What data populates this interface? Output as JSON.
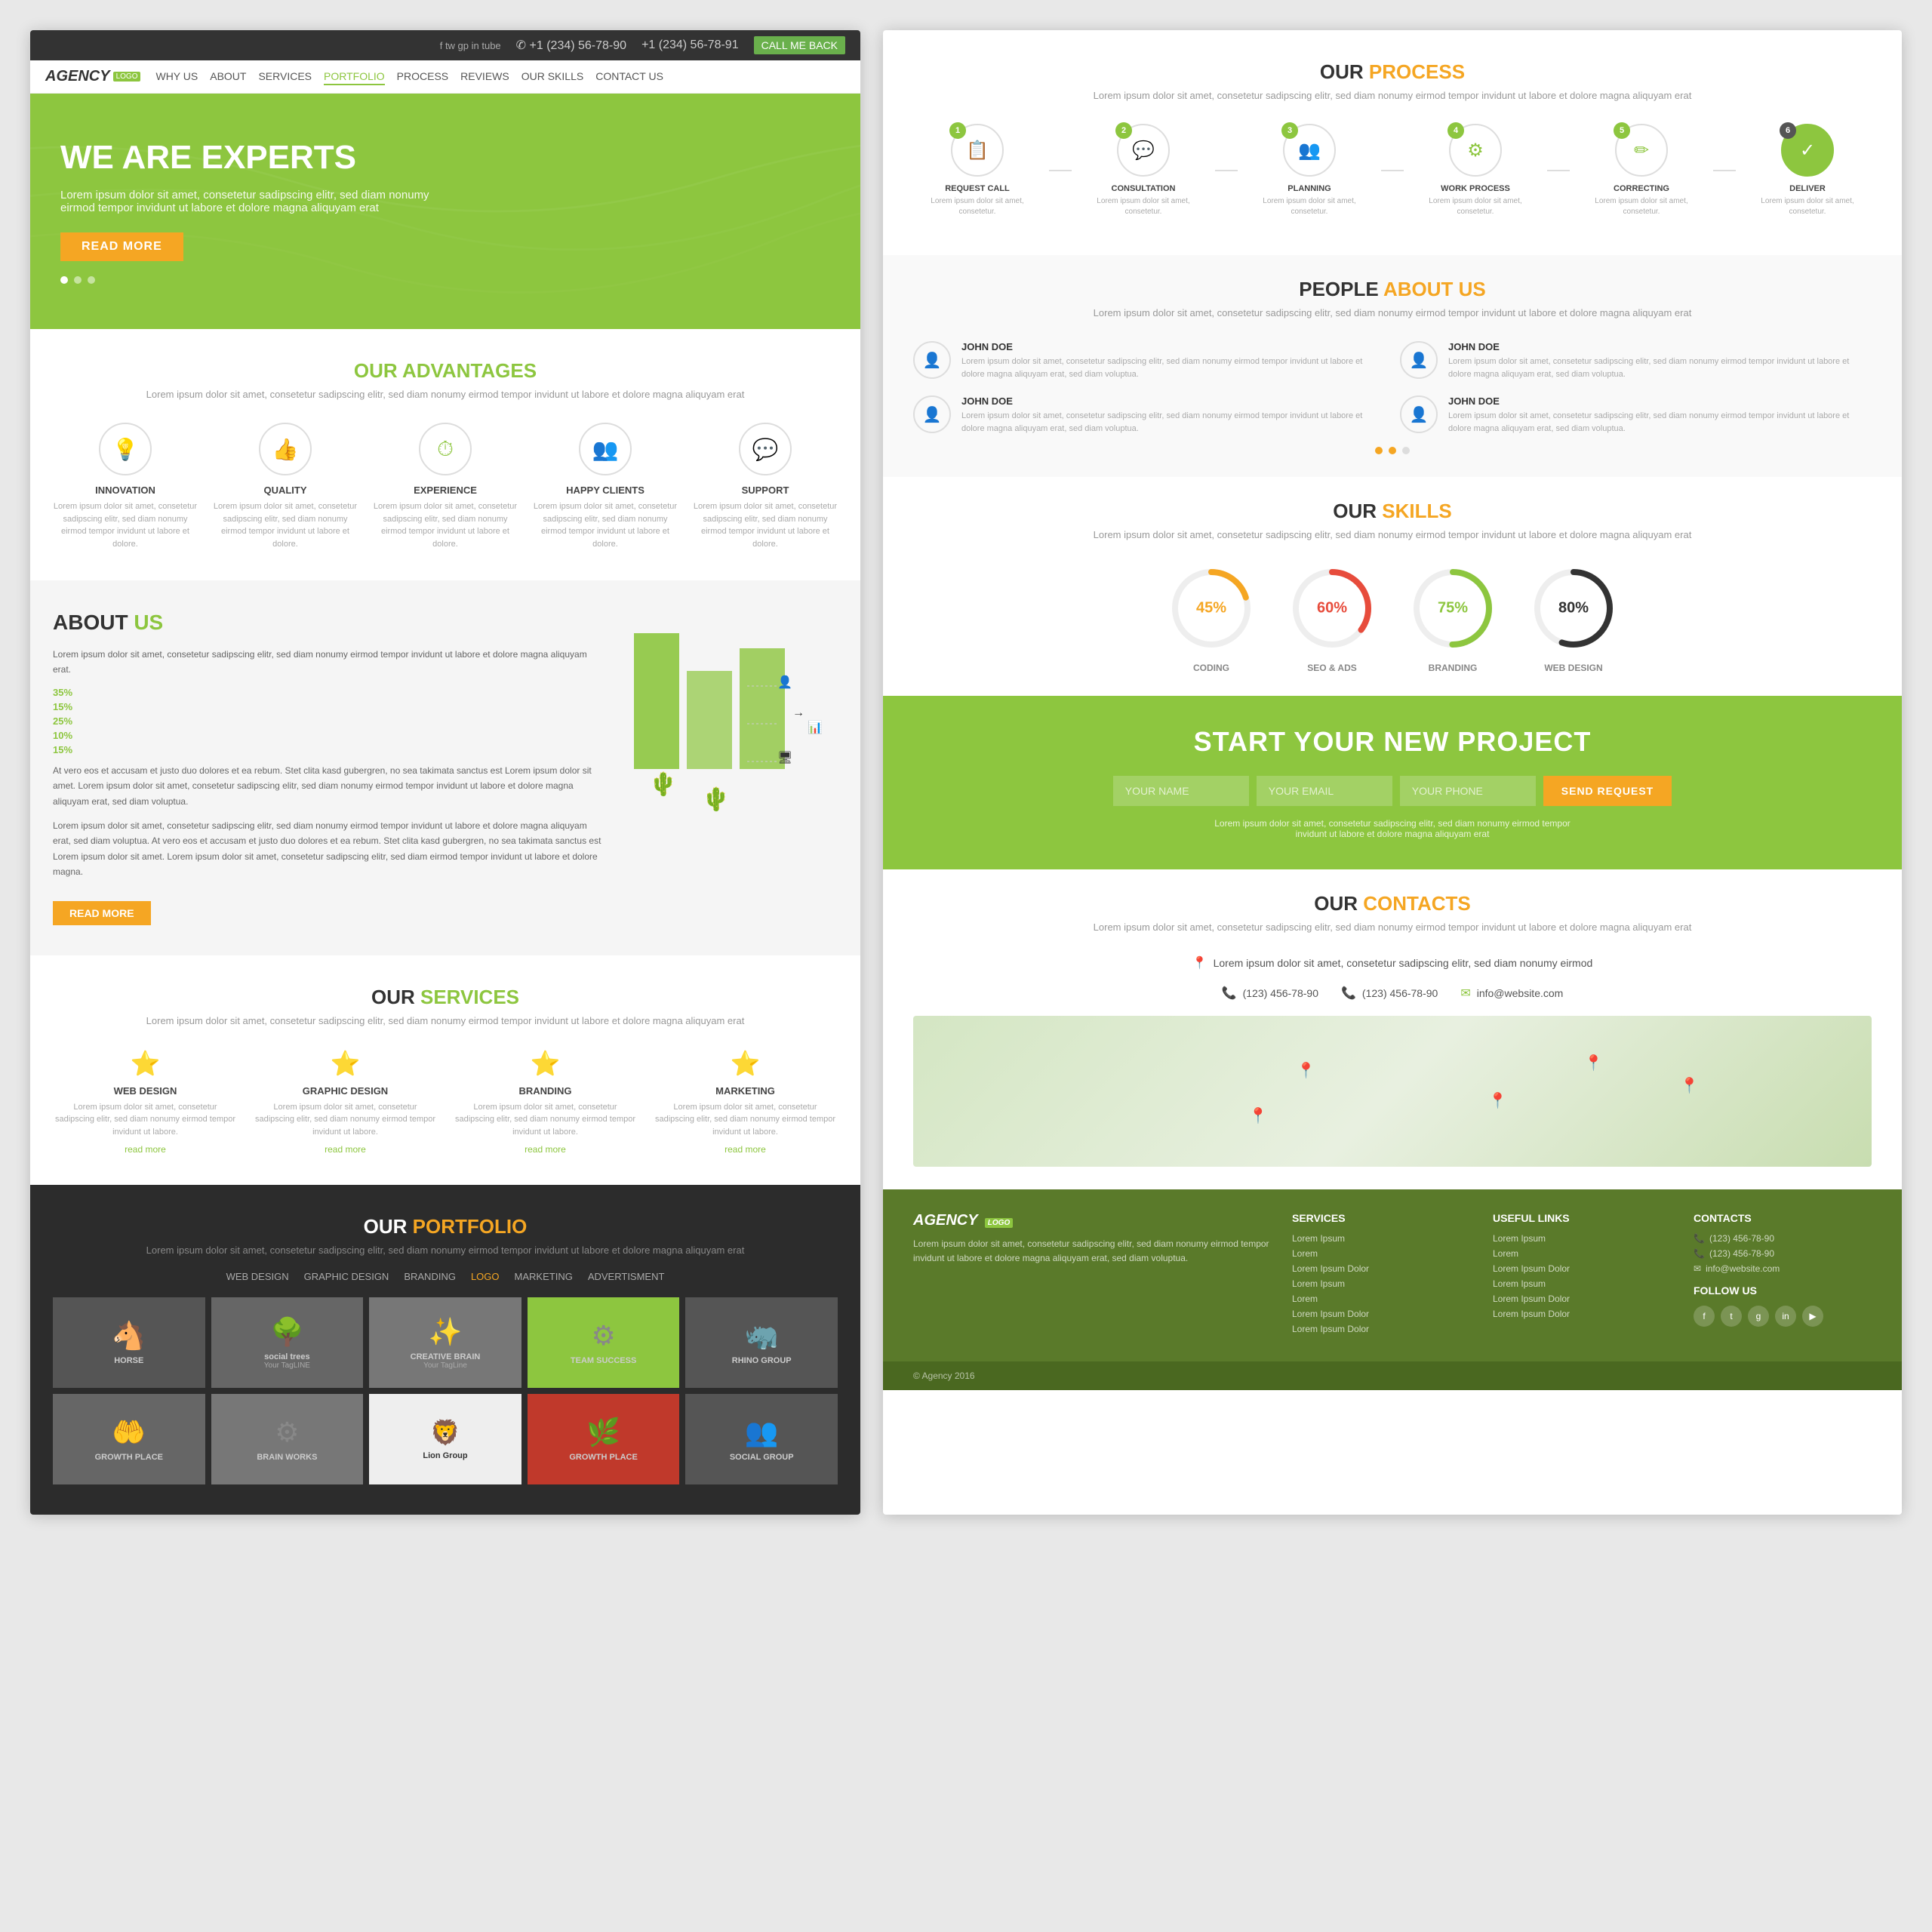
{
  "leftPanel": {
    "topBar": {
      "phone1": "✆ +1 (234) 56-78-90",
      "phone2": "+1 (234) 56-78-91",
      "callBtn": "CALL ME BACK",
      "socialIcons": [
        "f",
        "tw",
        "gp",
        "in",
        "tube"
      ]
    },
    "nav": {
      "logo": "AGENCY",
      "logoBadge": "LOGO",
      "items": [
        "WHY US",
        "ABOUT",
        "SERVICES",
        "PORTFOLIO",
        "PROCESS",
        "REVIEWS",
        "OUR SKILLS",
        "CONTACT US"
      ],
      "activeItem": "PORTFOLIO"
    },
    "hero": {
      "title": "WE ARE EXPERTS",
      "subtitle": "Lorem ipsum dolor sit amet, consetetur sadipscing elitr, sed diam nonumy eirmod tempor invidunt ut labore et dolore magna aliquyam erat",
      "btnLabel": "READ MORE",
      "dots": [
        true,
        false,
        false
      ]
    },
    "advantages": {
      "title": "OUR",
      "titleAccent": "ADVANTAGES",
      "subtitle": "Lorem ipsum dolor sit amet, consetetur sadipscing elitr, sed diam nonumy eirmod tempor invidunt ut labore et dolore magna aliquyam erat",
      "items": [
        {
          "icon": "💡",
          "title": "INNOVATION",
          "desc": "Lorem ipsum dolor sit amet, consetetur sadipscing elitr, sed diam nonumy eirmod tempor invidunt ut labore et dolore."
        },
        {
          "icon": "👍",
          "title": "QUALITY",
          "desc": "Lorem ipsum dolor sit amet, consetetur sadipscing elitr, sed diam nonumy eirmod tempor invidunt ut labore et dolore."
        },
        {
          "icon": "⏱",
          "title": "EXPERIENCE",
          "desc": "Lorem ipsum dolor sit amet, consetetur sadipscing elitr, sed diam nonumy eirmod tempor invidunt ut labore et dolore."
        },
        {
          "icon": "👥",
          "title": "HAPPY CLIENTS",
          "desc": "Lorem ipsum dolor sit amet, consetetur sadipscing elitr, sed diam nonumy eirmod tempor invidunt ut labore et dolore."
        },
        {
          "icon": "💬",
          "title": "SUPPORT",
          "desc": "Lorem ipsum dolor sit amet, consetetur sadipscing elitr, sed diam nonumy eirmod tempor invidunt ut labore et dolore."
        }
      ]
    },
    "about": {
      "title": "ABOUT",
      "titleAccent": "US",
      "text1": "Lorem ipsum dolor sit amet, consetetur sadipscing elitr, sed diam nonumy eirmod tempor invidunt ut labore et dolore magna aliquyam erat.",
      "text2": "At vero eos et accusam et justo duo dolores et ea rebum. Stet clita kasd gubergren, no sea takimata sanctus est Lorem ipsum dolor sit amet. Lorem ipsum dolor sit amet, consetetur sadipscing elitr, sed diam nonumy eirmod tempor invidunt ut labore et dolore magna aliquyam erat, sed diam voluptua.",
      "text3": "Lorem ipsum dolor sit amet, consetetur sadipscing elitr, sed diam nonumy eirmod tempor invidunt ut labore et dolore magna aliquyam erat, sed diam voluptua. At vero eos et accusam et justo duo dolores et ea rebum. Stet clita kasd gubergren, no sea takimata sanctus est Lorem ipsum dolor sit amet. Lorem ipsum dolor sit amet, consetetur sadipscing elitr, sed diam eirmod tempor invidunt ut labore et dolore magna.",
      "listItems": [
        {
          "pct": "35%",
          "label": ""
        },
        {
          "pct": "15%",
          "label": ""
        },
        {
          "pct": "25%",
          "label": ""
        },
        {
          "pct": "10%",
          "label": ""
        },
        {
          "pct": "15%",
          "label": ""
        }
      ],
      "btnLabel": "READ MORE"
    },
    "services": {
      "title": "OUR",
      "titleAccent": "SERVICES",
      "subtitle": "Lorem ipsum dolor sit amet, consetetur sadipscing elitr, sed diam nonumy eirmod tempor invidunt ut labore et dolore magna aliquyam erat",
      "items": [
        {
          "title": "WEB DESIGN",
          "desc": "Lorem ipsum dolor sit amet, consetetur sadipscing elitr, sed diam nonumy eirmod tempor invidunt ut labore et dolore.",
          "link": "read more"
        },
        {
          "title": "GRAPHIC DESIGN",
          "desc": "Lorem ipsum dolor sit amet, consetetur sadipscing elitr, sed diam nonumy eirmod tempor invidunt ut labore et dolore.",
          "link": "read more"
        },
        {
          "title": "BRANDING",
          "desc": "Lorem ipsum dolor sit amet, consetetur sadipscing elitr, sed diam nonumy eirmod tempor invidunt ut labore et dolore.",
          "link": "read more"
        },
        {
          "title": "MARKETING",
          "desc": "Lorem ipsum dolor sit amet, consetetur sadipscing elitr, sed diam nonumy eirmod tempor invidunt ut labore et dolore.",
          "link": "read more"
        }
      ]
    },
    "portfolio": {
      "title": "OUR",
      "titleAccent": "PORTFOLIO",
      "subtitle": "Lorem ipsum dolor sit amet, consetetur sadipscing elitr, sed diam nonumy eirmod tempor invidunt ut labore et dolore magna aliquyam erat",
      "tabs": [
        "WEB DESIGN",
        "GRAPHIC DESIGN",
        "BRANDING",
        "LOGO",
        "MARKETING",
        "ADVERTISMENT"
      ],
      "activeTab": "LOGO",
      "items": [
        {
          "icon": "🐴",
          "label": "HORSE",
          "sub": "",
          "bg": "#555"
        },
        {
          "icon": "🌳",
          "label": "social trees",
          "sub": "Your TagLINE",
          "bg": "#666"
        },
        {
          "icon": "✨",
          "label": "CREATIVE BRAIN",
          "sub": "Your TagLine",
          "bg": "#777"
        },
        {
          "icon": "⚙",
          "label": "TEAM SUCCESS",
          "sub": "",
          "bg": "#8dc63f"
        },
        {
          "icon": "🦏",
          "label": "RHINO GROUP",
          "sub": "",
          "bg": "#555"
        },
        {
          "icon": "🤲",
          "label": "GROWTH PLACE",
          "sub": "",
          "bg": "#666"
        },
        {
          "icon": "⚙",
          "label": "BRAIN WORKS",
          "sub": "",
          "bg": "#777"
        },
        {
          "icon": "🦁",
          "label": "Lion Group",
          "sub": "",
          "bg": "#fff"
        },
        {
          "icon": "🌿",
          "label": "GROWTH PLACE",
          "sub": "",
          "bg": "#c0392b"
        },
        {
          "icon": "👥",
          "label": "SOCIAL GROUP",
          "sub": "",
          "bg": "#555"
        }
      ]
    }
  },
  "rightPanel": {
    "process": {
      "title": "OUR",
      "titleAccent": "PROCESS",
      "subtitle": "Lorem ipsum dolor sit amet, consetetur sadipscing elitr, sed diam nonumy eirmod tempor invidunt ut labore et dolore magna aliquyam erat",
      "steps": [
        {
          "num": "1",
          "icon": "📋",
          "title": "REQUEST CALL",
          "desc": "Lorem ipsum dolor sit amet, consetetur."
        },
        {
          "num": "2",
          "icon": "💬",
          "title": "CONSULTATION",
          "desc": "Lorem ipsum dolor sit amet, consetetur."
        },
        {
          "num": "3",
          "icon": "👥",
          "title": "PLANNING",
          "desc": "Lorem ipsum dolor sit amet, consetetur."
        },
        {
          "num": "4",
          "icon": "⚙",
          "title": "WORK PROCESS",
          "desc": "Lorem ipsum dolor sit amet, consetetur."
        },
        {
          "num": "5",
          "icon": "✏",
          "title": "CORRECTING",
          "desc": "Lorem ipsum dolor sit amet, consetetur."
        },
        {
          "num": "6",
          "icon": "✅",
          "title": "DELIVER",
          "desc": "Lorem ipsum dolor sit amet, consetetur."
        }
      ]
    },
    "people": {
      "title": "PEOPLE",
      "titleAccent": "ABOUT US",
      "subtitle": "Lorem ipsum dolor sit amet, consetetur sadipscing elitr, sed diam nonumy eirmod tempor invidunt ut labore et dolore magna aliquyam erat",
      "persons": [
        {
          "name": "JOHN DOE",
          "desc": "Lorem ipsum dolor sit amet, consetetur sadipscing elitr, sed diam nonumy eirmod tempor invidunt ut labore et dolore magna aliquyam erat, sed diam voluptua."
        },
        {
          "name": "JOHN DOE",
          "desc": "Lorem ipsum dolor sit amet, consetetur sadipscing elitr, sed diam nonumy eirmod tempor invidunt ut labore et dolore magna aliquyam erat, sed diam voluptua."
        },
        {
          "name": "JOHN DOE",
          "desc": "Lorem ipsum dolor sit amet, consetetur sadipscing elitr, sed diam nonumy eirmod tempor invidunt ut labore et dolore magna aliquyam erat, sed diam voluptua."
        },
        {
          "name": "JOHN DOE",
          "desc": "Lorem ipsum dolor sit amet, consetetur sadipscing elitr, sed diam nonumy eirmod tempor invidunt ut labore et dolore magna aliquyam erat, sed diam voluptua."
        }
      ],
      "dots": [
        true,
        true,
        false
      ]
    },
    "skills": {
      "title": "OUR",
      "titleAccent": "SKILLS",
      "subtitle": "Lorem ipsum dolor sit amet, consetetur sadipscing elitr, sed diam nonumy eirmod tempor invidunt ut labore et dolore magna aliquyam erat",
      "items": [
        {
          "label": "CODING",
          "pct": "45%",
          "value": 45,
          "color": "yellow"
        },
        {
          "label": "SEO & ADS",
          "pct": "60%",
          "value": 60,
          "color": "red"
        },
        {
          "label": "BRANDING",
          "pct": "75%",
          "value": 75,
          "color": "green"
        },
        {
          "label": "WEB DESIGN",
          "pct": "80%",
          "value": 80,
          "color": "dark"
        }
      ]
    },
    "project": {
      "title": "START YOUR NEW PROJECT",
      "namePlaceholder": "YOUR NAME",
      "emailPlaceholder": "YOUR EMAIL",
      "phonePlaceholder": "YOUR PHONE",
      "btnLabel": "SEND REQUEST",
      "desc": "Lorem ipsum dolor sit amet, consetetur sadipscing elitr, sed diam nonumy eirmod tempor invidunt ut labore et dolore magna aliquyam erat"
    },
    "contacts": {
      "title": "OUR",
      "titleAccent": "CONTACTS",
      "subtitle": "Lorem ipsum dolor sit amet, consetetur sadipscing elitr, sed diam nonumy eirmod tempor invidunt ut labore et dolore magna aliquyam erat",
      "address": "Lorem ipsum dolor sit amet, consetetur sadipscing elitr, sed diam nonumy eirmod",
      "phone1": "(123) 456-78-90",
      "phone2": "(123) 456-78-90",
      "email": "info@website.com"
    },
    "footer": {
      "logo": "AGENCY",
      "logoBadge": "LOGO",
      "desc": "Lorem ipsum dolor sit amet, consetetur sadipscing elitr, sed diam nonumy eirmod tempor invidunt ut labore et dolore magna aliquyam erat, sed diam voluptua.",
      "servicesTitle": "SERVICES",
      "servicesLinks": [
        "Lorem Ipsum",
        "Lorem",
        "Lorem Ipsum Dolor",
        "Lorem Ipsum",
        "Lorem",
        "Lorem Ipsum Dolor",
        "Lorem Ipsum Dolor"
      ],
      "usefulTitle": "USEFUL LINKS",
      "usefulLinks": [
        "Lorem Ipsum",
        "Lorem",
        "Lorem Ipsum Dolor",
        "Lorem Ipsum",
        "Lorem Ipsum Dolor",
        "Lorem Ipsum Dolor"
      ],
      "contactsTitle": "CONTACTS",
      "phone1": "(123) 456-78-90",
      "phone2": "(123) 456-78-90",
      "emailFooter": "info@website.com",
      "followTitle": "FOLLOW US",
      "copyright": "© Agency 2016"
    }
  }
}
